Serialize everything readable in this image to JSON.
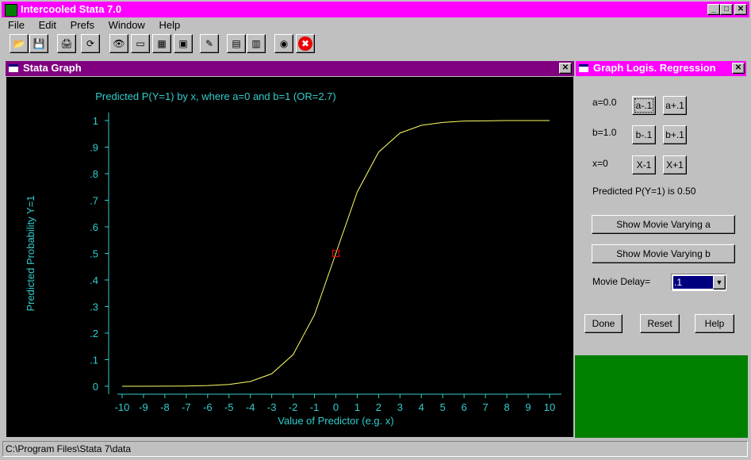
{
  "app": {
    "title": "Intercooled Stata 7.0"
  },
  "menu": [
    "File",
    "Edit",
    "Prefs",
    "Window",
    "Help"
  ],
  "toolbar": [
    "open-icon",
    "save-icon",
    "print-icon",
    "log-icon",
    "viewer-icon",
    "results-icon",
    "graph-icon",
    "do-editor-icon",
    "editor-icon",
    "data-editor-icon",
    "data-browser-icon",
    "more-icon",
    "break-icon"
  ],
  "graph_window": {
    "title": "Stata Graph"
  },
  "dialog": {
    "title": "Graph Logis. Regression",
    "a_label": "a=0.0",
    "b_label": "b=1.0",
    "x_label": "x=0",
    "a_minus": "a-.1",
    "a_plus": "a+.1",
    "b_minus": "b-.1",
    "b_plus": "b+.1",
    "x_minus": "X-1",
    "x_plus": "X+1",
    "predicted": "Predicted P(Y=1) is 0.50",
    "movie_a": "Show Movie Varying a",
    "movie_b": "Show Movie Varying b",
    "delay_label": "Movie Delay=",
    "delay_value": ".1",
    "done": "Done",
    "reset": "Reset",
    "help": "Help"
  },
  "status": {
    "path": "C:\\Program Files\\Stata 7\\data"
  },
  "chart_data": {
    "type": "line",
    "title": "Predicted P(Y=1) by x, where a=0 and b=1 (OR=2.7)",
    "xlabel": "Value of Predictor (e.g. x)",
    "ylabel": "Predicted Probability Y=1",
    "xlim": [
      -10,
      10
    ],
    "ylim": [
      0,
      1
    ],
    "x_ticks": [
      "-10",
      "-9",
      "-8",
      "-7",
      "-6",
      "-5",
      "-4",
      "-3",
      "-2",
      "-1",
      "0",
      "1",
      "2",
      "3",
      "4",
      "5",
      "6",
      "7",
      "8",
      "9",
      "10"
    ],
    "y_ticks": [
      "0",
      ".1",
      ".2",
      ".3",
      ".4",
      ".5",
      ".6",
      ".7",
      ".8",
      ".9",
      "1"
    ],
    "x": [
      -10,
      -9,
      -8,
      -7,
      -6,
      -5,
      -4,
      -3,
      -2,
      -1,
      0,
      1,
      2,
      3,
      4,
      5,
      6,
      7,
      8,
      9,
      10
    ],
    "y": [
      5e-05,
      0.0001,
      0.0003,
      0.0009,
      0.0025,
      0.0067,
      0.018,
      0.047,
      0.119,
      0.269,
      0.5,
      0.731,
      0.881,
      0.953,
      0.982,
      0.993,
      0.998,
      0.999,
      1.0,
      1.0,
      1.0
    ],
    "marker": {
      "x": 0,
      "y": 0.5
    },
    "line_color": "#ffff66",
    "text_color": "#33cccc",
    "marker_color": "#ff0000"
  }
}
